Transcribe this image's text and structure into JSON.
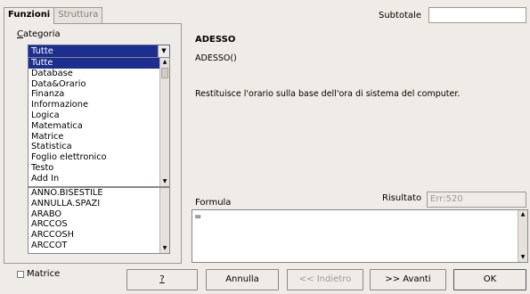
{
  "tabs": [
    {
      "label": "Funzioni",
      "active": true
    },
    {
      "label": "Struttura",
      "active": false
    }
  ],
  "subtotal": {
    "label": "Subtotale",
    "value": ""
  },
  "category": {
    "label": "Categoria",
    "selected": "Tutte",
    "options": [
      "Tutte",
      "Database",
      "Data&Orario",
      "Finanza",
      "Informazione",
      "Logica",
      "Matematica",
      "Matrice",
      "Statistica",
      "Foglio elettronico",
      "Testo",
      "Add In"
    ]
  },
  "functions": {
    "items": [
      "ANNO.BISESTILE",
      "ANNULLA.SPAZI",
      "ARABO",
      "ARCCOS",
      "ARCCOSH",
      "ARCCOT"
    ]
  },
  "detail": {
    "name": "ADESSO",
    "syntax": "ADESSO()",
    "description": "Restituisce l'orario sulla base dell'ora di sistema del computer."
  },
  "formula": {
    "label": "Formula",
    "value": "="
  },
  "result": {
    "label": "Risultato",
    "value": "Err:520"
  },
  "matrix": {
    "label": "Matrice",
    "checked": false
  },
  "buttons": {
    "help": "?",
    "cancel": "Annulla",
    "back": "<< Indietro",
    "next": ">> Avanti",
    "ok": "OK"
  }
}
